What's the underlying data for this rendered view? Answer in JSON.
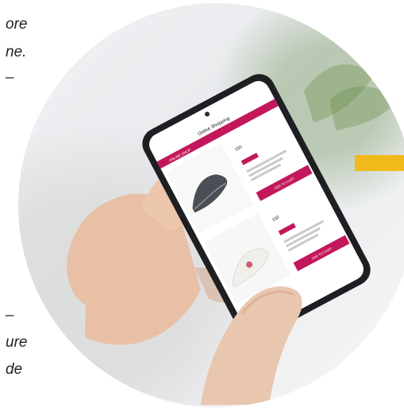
{
  "left_text_fragments": [
    "ore",
    "ne.",
    "–",
    "–",
    "ure",
    "de"
  ],
  "phone": {
    "app_title": "Online Shopping",
    "top_strip": "ONLINE SHOP",
    "products": [
      {
        "price": "150",
        "button": "ADD TO CART"
      },
      {
        "price": "150",
        "button": "ADD TO CART"
      }
    ]
  },
  "colors": {
    "accent_bar": "#f2b91a",
    "phone_strip": "#c2185b",
    "phone_frame": "#1d1f22"
  }
}
